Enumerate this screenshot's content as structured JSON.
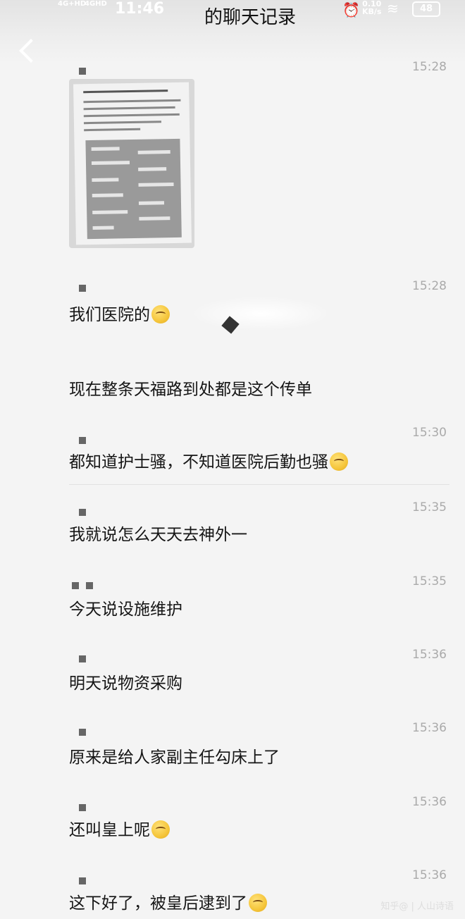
{
  "status_bar": {
    "network_1": "4G+HD",
    "network_2": "4GHD",
    "time": "11:46",
    "speed_value": "0.10",
    "speed_unit": "KB/s",
    "battery": "48"
  },
  "header": {
    "title": "的聊天记录"
  },
  "messages": [
    {
      "time": "15:28",
      "text": ""
    },
    {
      "time": "15:28",
      "text": "我们医院的"
    },
    {
      "time": "",
      "text": "现在整条天福路到处都是这个传单"
    },
    {
      "time": "15:30",
      "text": "都知道护士骚，不知道医院后勤也骚"
    },
    {
      "time": "15:35",
      "text": "我就说怎么天天去神外一"
    },
    {
      "time": "15:35",
      "text": "今天说设施维护"
    },
    {
      "time": "15:36",
      "text": "明天说物资采购"
    },
    {
      "time": "15:36",
      "text": "原来是给人家副主任勾床上了"
    },
    {
      "time": "15:36",
      "text": "还叫皇上呢"
    },
    {
      "time": "15:36",
      "text": "这下好了，被皇后逮到了"
    }
  ],
  "watermark": "知乎@ | 人山诗语"
}
